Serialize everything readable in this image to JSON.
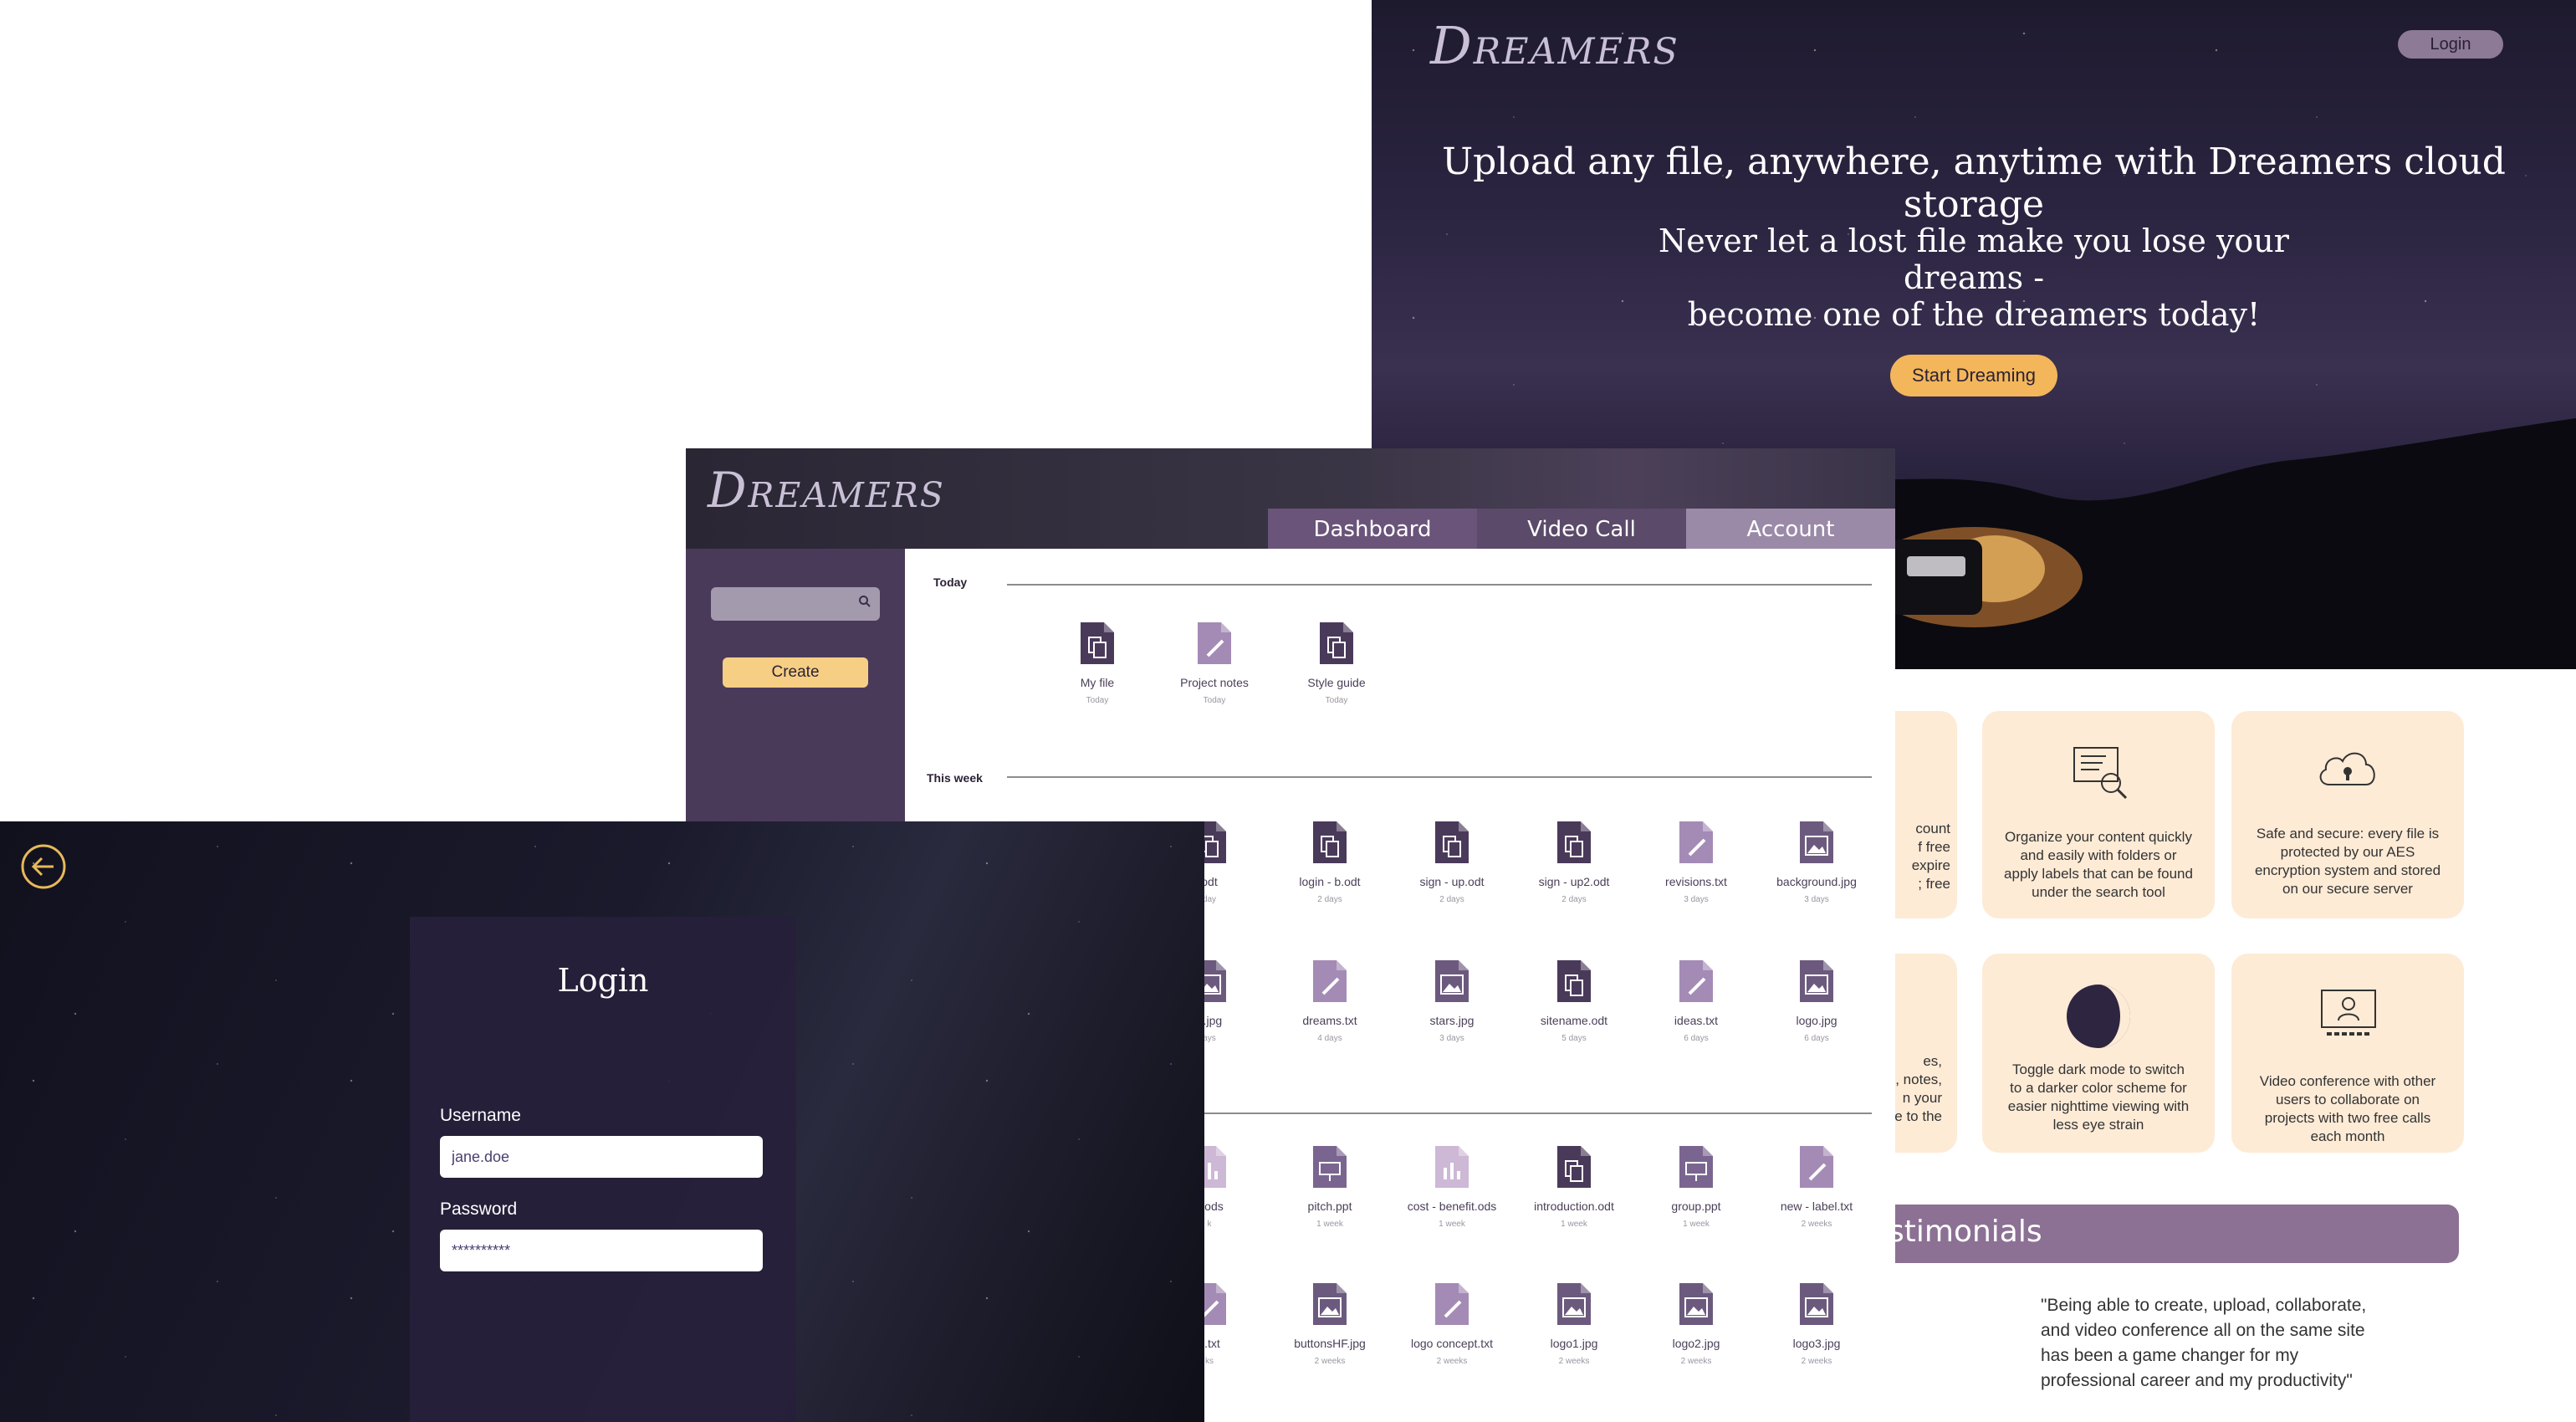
{
  "landing": {
    "brand": "Dreamers",
    "login_label": "Login",
    "hero_title": "Upload any file, anywhere, anytime with Dreamers cloud storage",
    "hero_subtitle_1": "Never let a lost file make you lose your dreams -",
    "hero_subtitle_2": "become one of the dreamers today!",
    "cta_label": "Start Dreaming",
    "features": [
      {
        "icon": "partial-icon",
        "lines": [
          "count",
          "f free",
          "expire",
          "; free"
        ]
      },
      {
        "icon": "search-document-icon",
        "lines": [
          "Organize your content quickly",
          "and easily with folders or",
          "apply labels that can be found",
          "under the search tool"
        ]
      },
      {
        "icon": "cloud-lock-icon",
        "lines": [
          "Safe and secure: every file is",
          "protected by our AES",
          "encryption system and stored",
          "on our secure server"
        ]
      },
      {
        "icon": "partial-icon",
        "lines": [
          "es,",
          "ts, notes,",
          "n your",
          "ce to the"
        ]
      },
      {
        "icon": "moon-icon",
        "lines": [
          "Toggle dark mode to switch",
          "to a darker color scheme for",
          "easier nighttime viewing with",
          "less eye strain"
        ]
      },
      {
        "icon": "video-conference-icon",
        "lines": [
          "Video conference with other",
          "users to collaborate on",
          "projects with two free calls",
          "each month"
        ]
      }
    ],
    "testimonials_heading": "Testimonials",
    "quote_lines": [
      "\"Being able to create, upload, collaborate,",
      "and video conference all on the same site",
      "has been a game changer for my",
      "professional career and my productivity\""
    ]
  },
  "dashboard": {
    "brand": "Dreamers",
    "tabs": [
      "Dashboard",
      "Video Call",
      "Account"
    ],
    "create_label": "Create",
    "section_today": "Today",
    "section_week": "This week",
    "today_files": [
      {
        "name": "My file",
        "date": "Today",
        "type": "document"
      },
      {
        "name": "Project notes",
        "date": "Today",
        "type": "text"
      },
      {
        "name": "Style guide",
        "date": "Today",
        "type": "document"
      }
    ],
    "week_row1": [
      {
        "name": "odt",
        "date": "day",
        "type": "document"
      },
      {
        "name": "login - b.odt",
        "date": "2 days",
        "type": "document"
      },
      {
        "name": "sign - up.odt",
        "date": "2 days",
        "type": "document"
      },
      {
        "name": "sign - up2.odt",
        "date": "2 days",
        "type": "document"
      },
      {
        "name": "revisions.txt",
        "date": "3 days",
        "type": "text"
      },
      {
        "name": "background.jpg",
        "date": "3 days",
        "type": "image"
      }
    ],
    "week_row2": [
      {
        "name": "e.jpg",
        "date": "ays",
        "type": "image"
      },
      {
        "name": "dreams.txt",
        "date": "4 days",
        "type": "text"
      },
      {
        "name": "stars.jpg",
        "date": "3 days",
        "type": "image"
      },
      {
        "name": "sitename.odt",
        "date": "5 days",
        "type": "document"
      },
      {
        "name": "ideas.txt",
        "date": "6 days",
        "type": "text"
      },
      {
        "name": "logo.jpg",
        "date": "6 days",
        "type": "image"
      }
    ],
    "older_row1": [
      {
        "name": "s.ods",
        "date": "k",
        "type": "sheet"
      },
      {
        "name": "pitch.ppt",
        "date": "1 week",
        "type": "slides"
      },
      {
        "name": "cost - benefit.ods",
        "date": "1 week",
        "type": "sheet"
      },
      {
        "name": "introduction.odt",
        "date": "1 week",
        "type": "document"
      },
      {
        "name": "group.ppt",
        "date": "1 week",
        "type": "slides"
      },
      {
        "name": "new - label.txt",
        "date": "2 weeks",
        "type": "text"
      }
    ],
    "older_row2": [
      {
        "name": "s.txt",
        "date": "ks",
        "type": "text"
      },
      {
        "name": "buttonsHF.jpg",
        "date": "2 weeks",
        "type": "image"
      },
      {
        "name": "logo concept.txt",
        "date": "2 weeks",
        "type": "text"
      },
      {
        "name": "logo1.jpg",
        "date": "2 weeks",
        "type": "image"
      },
      {
        "name": "logo2.jpg",
        "date": "2 weeks",
        "type": "image"
      },
      {
        "name": "logo3.jpg",
        "date": "2 weeks",
        "type": "image"
      }
    ]
  },
  "login": {
    "title": "Login",
    "username_label": "Username",
    "username_value": "jane.doe",
    "password_label": "Password",
    "password_value": "**********"
  },
  "colors": {
    "accent": "#f3b65a",
    "purple_dark": "#4a3a5a",
    "purple_light": "#a48bb6",
    "feature_bg": "#fdebd6"
  }
}
